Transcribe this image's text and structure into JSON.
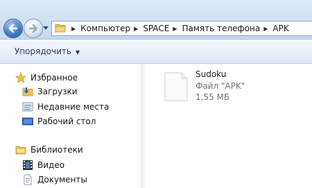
{
  "address": {
    "crumbs": [
      "Компьютер",
      "SPACE",
      "Память телефона",
      "APK"
    ]
  },
  "toolbar": {
    "organize_label": "Упорядочить"
  },
  "nav": {
    "favorites_label": "Избранное",
    "downloads_label": "Загрузки",
    "recent_label": "Недавние места",
    "desktop_label": "Рабочий стол",
    "libraries_label": "Библиотеки",
    "video_label": "Видео",
    "documents_label": "Документы"
  },
  "file": {
    "name": "Sudoku",
    "type": "Файл \"APK\"",
    "size": "1,55 МБ"
  },
  "icons": {
    "back": "back-arrow-icon",
    "forward": "forward-arrow-icon",
    "star": "star-icon",
    "library": "library-icon"
  }
}
